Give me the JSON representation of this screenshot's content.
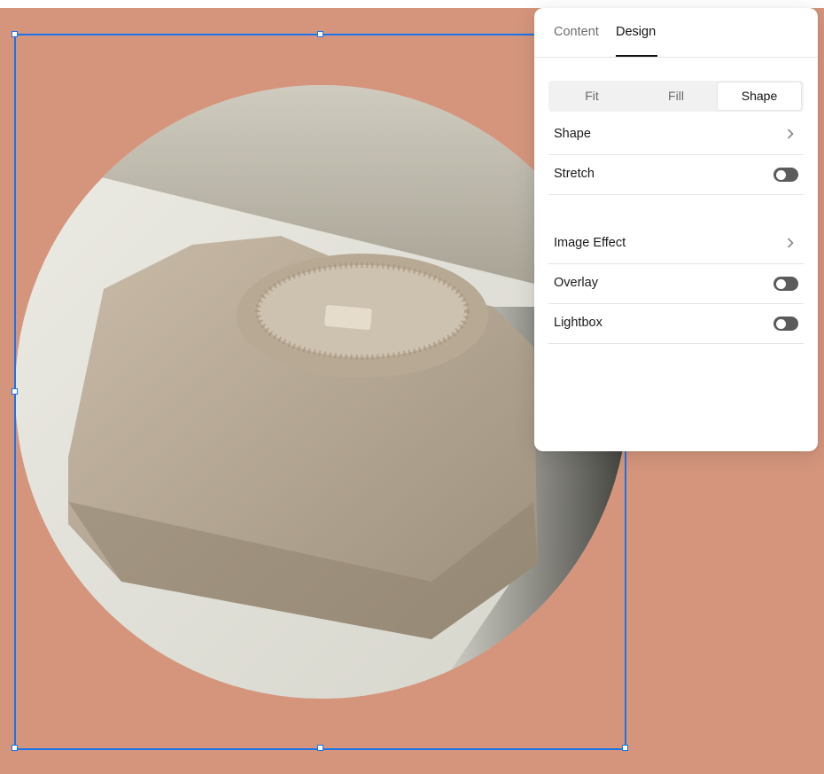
{
  "canvas": {
    "background_color": "#d4957c",
    "image": {
      "subject": "folded beige sweater on table",
      "shape": "circle"
    },
    "selection_color": "#1a73e8"
  },
  "panel": {
    "tabs": [
      {
        "label": "Content",
        "active": false
      },
      {
        "label": "Design",
        "active": true
      }
    ],
    "segmented": {
      "options": [
        "Fit",
        "Fill",
        "Shape"
      ],
      "selected": "Shape"
    },
    "rows": {
      "shape": {
        "label": "Shape",
        "control": "chevron-right-icon"
      },
      "stretch": {
        "label": "Stretch",
        "control": "toggle",
        "on": false
      },
      "image_effect": {
        "label": "Image Effect",
        "control": "chevron-right-icon"
      },
      "overlay": {
        "label": "Overlay",
        "control": "toggle",
        "on": false
      },
      "lightbox": {
        "label": "Lightbox",
        "control": "toggle",
        "on": false
      }
    }
  }
}
